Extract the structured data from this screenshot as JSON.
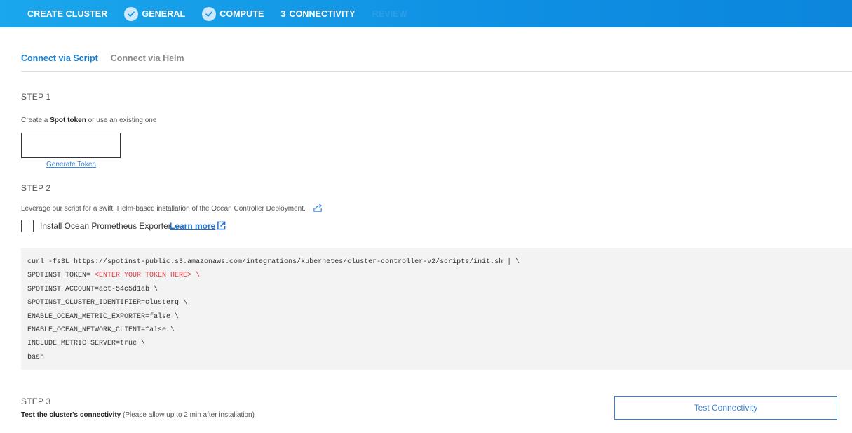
{
  "wizard": {
    "steps": [
      {
        "label": "CREATE CLUSTER"
      },
      {
        "label": "GENERAL",
        "done": true
      },
      {
        "label": "COMPUTE",
        "done": true
      },
      {
        "number": "3",
        "label": "CONNECTIVITY"
      },
      {
        "label": "REVIEW"
      }
    ]
  },
  "tabs": [
    "Connect via Script",
    "Connect via Helm"
  ],
  "step1": {
    "title": "STEP 1",
    "desc_prefix": "Create a ",
    "desc_bold": "Spot token",
    "desc_suffix": " or use an existing one",
    "token_value": "",
    "generate_label": "Generate Token"
  },
  "step2": {
    "title": "STEP 2",
    "desc": "Leverage our script for a swift, Helm-based installation of the Ocean Controller Deployment.",
    "checkbox_label": "Install Ocean Prometheus Exporter",
    "learn_more": "Learn more"
  },
  "code": {
    "line1": "curl -fsSL https://spotinst-public.s3.amazonaws.com/integrations/kubernetes/cluster-controller-v2/scripts/init.sh | \\",
    "line2_key": "SPOTINST_TOKEN= ",
    "line2_placeholder": "<ENTER YOUR TOKEN HERE> \\",
    "line3": "SPOTINST_ACCOUNT=act-54c5d1ab \\",
    "line4": "SPOTINST_CLUSTER_IDENTIFIER=clusterq \\",
    "line5": "ENABLE_OCEAN_METRIC_EXPORTER=false \\",
    "line6": "ENABLE_OCEAN_NETWORK_CLIENT=false \\",
    "line7": "INCLUDE_METRIC_SERVER=true \\",
    "line8": "bash"
  },
  "step3": {
    "title": "STEP 3",
    "desc_bold": "Test the cluster's connectivity",
    "desc_suffix": " (Please allow up to 2 min after installation)",
    "button": "Test Connectivity"
  },
  "colors": {
    "header": "#0f8fe3",
    "accent": "#1a7fd0",
    "code_bg": "#f3f3f3",
    "placeholder_red": "#d9363e"
  }
}
